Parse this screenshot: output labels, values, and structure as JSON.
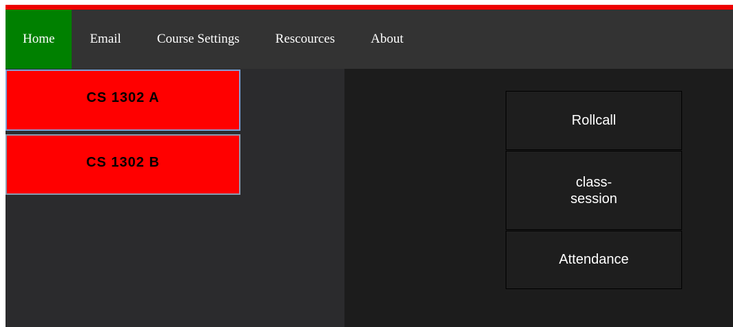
{
  "nav": {
    "items": [
      {
        "label": "Home",
        "active": true
      },
      {
        "label": "Email"
      },
      {
        "label": "Course Settings"
      },
      {
        "label": "Rescources"
      },
      {
        "label": "About"
      }
    ]
  },
  "courses": [
    {
      "label": "CS 1302 A"
    },
    {
      "label": "CS 1302 B"
    }
  ],
  "actions": {
    "rollcall": "Rollcall",
    "class_session": "class-session",
    "attendance": "Attendance"
  },
  "colors": {
    "accent_stripe": "#ee0000",
    "nav_background": "#333333",
    "active_nav": "#008000",
    "course_button": "#ff0000",
    "left_panel": "#2b2b2d",
    "right_panel": "#1c1c1c"
  }
}
